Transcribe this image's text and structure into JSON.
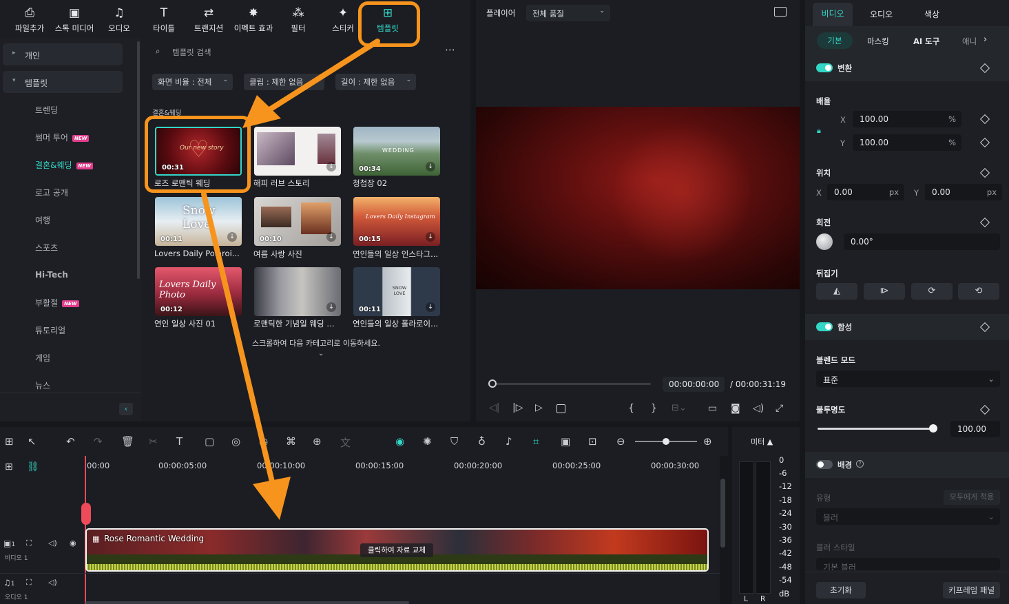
{
  "toolbar": {
    "items": [
      {
        "label": "파일추가",
        "icon": "import-icon"
      },
      {
        "label": "스톡 미디어",
        "icon": "stock-media-icon"
      },
      {
        "label": "오디오",
        "icon": "music-note-icon"
      },
      {
        "label": "타이틀",
        "icon": "text-icon"
      },
      {
        "label": "트랜지션",
        "icon": "transition-icon"
      },
      {
        "label": "이펙트 효과",
        "icon": "effects-icon"
      },
      {
        "label": "필터",
        "icon": "filter-icon"
      },
      {
        "label": "스티커",
        "icon": "sticker-icon"
      },
      {
        "label": "템플릿",
        "icon": "template-icon",
        "active": true
      }
    ]
  },
  "leftnav": {
    "personal": "개인",
    "templates": "템플릿",
    "items": [
      "트렌딩",
      "썸머 투어",
      "결혼&웨딩",
      "로고 공개",
      "여행",
      "스포츠",
      "Hi-Tech",
      "부활절",
      "튜토리얼",
      "게임",
      "뉴스"
    ],
    "new_badge": "NEW"
  },
  "templates": {
    "search_placeholder": "템플릿 검색",
    "filters": [
      "화면 비율 : 전체",
      "클립 : 제한 없음",
      "길이 : 제한 없음"
    ],
    "category": "결혼&웨딩",
    "cards": [
      {
        "title": "로즈 로맨틱 웨딩",
        "duration": "00:31",
        "overlay": "Our new story"
      },
      {
        "title": "해피 러브 스토리",
        "duration": ""
      },
      {
        "title": "청첩장 02",
        "duration": "00:34",
        "overlay": "WEDDING"
      },
      {
        "title": "Lovers Daily Polaroi...",
        "duration": "00:11",
        "overlay": "Snow Love"
      },
      {
        "title": "여름 사랑 사진",
        "duration": "00:10"
      },
      {
        "title": "연인들의 일상 인스타그...",
        "duration": "00:15",
        "overlay": "Lovers Daily Instagram"
      },
      {
        "title": "연인 일상 사진 01",
        "duration": "00:12",
        "overlay": "Lovers Daily Photo"
      },
      {
        "title": "로맨틱한 기념일 웨딩 스...",
        "duration": ""
      },
      {
        "title": "연인들의 일상 폴라로이...",
        "duration": "00:11",
        "overlay": "SNOW LOVE"
      }
    ],
    "scroll_hint": "스크롤하여 다음 카테고리로 이동하세요."
  },
  "player": {
    "label": "플레이어",
    "quality": "전체 품질",
    "current_time": "00:00:00:00",
    "total_time": "/ 00:00:31:19"
  },
  "right_panel": {
    "tabs": [
      "비디오",
      "오디오",
      "색상"
    ],
    "subtabs": [
      "기본",
      "마스킹",
      "AI 도구",
      "애니"
    ],
    "transform": "변환",
    "scale": "배율",
    "scale_x": "100.00",
    "scale_y": "100.00",
    "percent": "%",
    "position": "위치",
    "pos_x": "0.00",
    "pos_y": "0.00",
    "px": "px",
    "rotate": "회전",
    "rotate_val": "0.00°",
    "flip": "뒤집기",
    "compositing": "합성",
    "blend_mode": "블렌드 모드",
    "blend_val": "표준",
    "opacity": "불투명도",
    "opacity_val": "100.00",
    "opacity_level": 1.0,
    "background": "배경",
    "type": "유형",
    "apply_all": "모두에게 적용",
    "blur": "블러",
    "blur_style": "블러 스타일",
    "blur_style_val": "기본 블러",
    "reset": "초기화",
    "keyframe_panel": "키프레임 패널",
    "x": "X",
    "y": "Y"
  },
  "timeline": {
    "ticks": [
      "00:00",
      "00:00:05:00",
      "00:00:10:00",
      "00:00:15:00",
      "00:00:20:00",
      "00:00:25:00",
      "00:00:30:00"
    ],
    "clip_title": "Rose Romantic Wedding",
    "replace_hint": "클릭하여 자료 교체",
    "video_track": "비디오 1",
    "audio_track": "오디오 1",
    "track_num": "1"
  },
  "meter": {
    "label": "미터 ▲",
    "levels": [
      "0",
      "-6",
      "-12",
      "-18",
      "-24",
      "-30",
      "-36",
      "-42",
      "-48",
      "-54"
    ],
    "unit": "dB",
    "left": "L",
    "right": "R"
  },
  "colors": {
    "accent": "#34d6c6",
    "annotation": "#f7941d"
  }
}
